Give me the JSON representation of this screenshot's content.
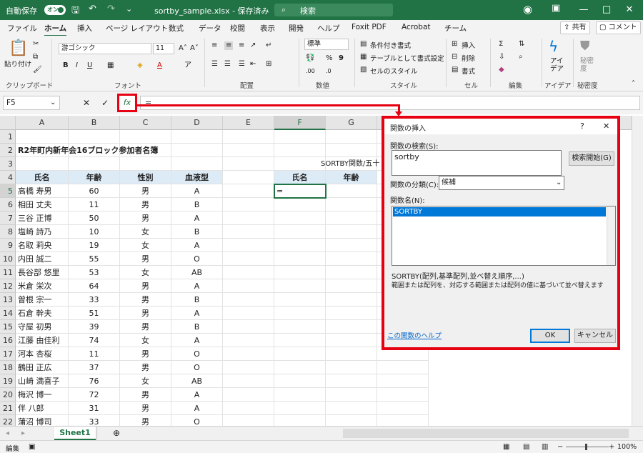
{
  "titlebar": {
    "autosave": "自動保存",
    "toggle": "オン",
    "filename": "sortby_sample.xlsx - 保存済み",
    "search": "検索",
    "minimize": "—",
    "maximize": "□",
    "close": "✕"
  },
  "tabs": [
    "ファイル",
    "ホーム",
    "挿入",
    "ページ レイアウト",
    "数式",
    "データ",
    "校閲",
    "表示",
    "開発",
    "ヘルプ",
    "Foxit PDF",
    "Acrobat",
    "チーム"
  ],
  "tab_buttons": {
    "share": "共有",
    "comment": "コメント"
  },
  "ribbon": {
    "clipboard": {
      "paste": "貼り付け",
      "label": "クリップボード"
    },
    "font": {
      "name": "游ゴシック",
      "size": "11",
      "label": "フォント"
    },
    "alignment": {
      "label": "配置"
    },
    "number": {
      "format": "標準",
      "label": "数値"
    },
    "style": {
      "cond": "条件付き書式",
      "table": "テーブルとして書式設定",
      "cell": "セルのスタイル",
      "label": "スタイル"
    },
    "cells": {
      "insert": "挿入",
      "delete": "削除",
      "format": "書式",
      "label": "セル"
    },
    "edit": {
      "label": "編集"
    },
    "idea": {
      "btn": "アイ デア",
      "label": "アイデア"
    },
    "sensitivity": {
      "btn": "秘密 度",
      "label": "秘密度"
    }
  },
  "formula_bar": {
    "namebox": "F5",
    "fx": "fx",
    "formula": "="
  },
  "columns": [
    "A",
    "B",
    "C",
    "D",
    "E",
    "F",
    "G"
  ],
  "rows": [
    "1",
    "2",
    "3",
    "4",
    "5",
    "6",
    "7",
    "8",
    "9",
    "10",
    "11",
    "12",
    "13",
    "14",
    "15",
    "16",
    "17",
    "18",
    "19",
    "20",
    "21",
    "22"
  ],
  "sheet": {
    "title": "R2年町内新年会16ブロック参加者名簿",
    "headers": [
      "氏名",
      "年齢",
      "性別",
      "血液型"
    ],
    "note": "SORTBY関数/五十",
    "out_headers": [
      "氏名",
      "年齢"
    ],
    "active_value": "=",
    "records": [
      [
        "高橋 寿男",
        "60",
        "男",
        "A"
      ],
      [
        "相田 丈夫",
        "11",
        "男",
        "B"
      ],
      [
        "三谷 正博",
        "50",
        "男",
        "A"
      ],
      [
        "塩崎 詩乃",
        "10",
        "女",
        "B"
      ],
      [
        "名取 莉央",
        "19",
        "女",
        "A"
      ],
      [
        "内田 誠二",
        "55",
        "男",
        "O"
      ],
      [
        "長谷部 悠里",
        "53",
        "女",
        "AB"
      ],
      [
        "米倉 栄次",
        "64",
        "男",
        "A"
      ],
      [
        "曽根 宗一",
        "33",
        "男",
        "B"
      ],
      [
        "石倉 幹夫",
        "51",
        "男",
        "A"
      ],
      [
        "守屋 初男",
        "39",
        "男",
        "B"
      ],
      [
        "江藤 由佳利",
        "74",
        "女",
        "A"
      ],
      [
        "河本 杏桜",
        "11",
        "男",
        "O"
      ],
      [
        "鶴田 正広",
        "37",
        "男",
        "O"
      ],
      [
        "山崎 満喜子",
        "76",
        "女",
        "AB"
      ],
      [
        "梅沢 博一",
        "72",
        "男",
        "A"
      ],
      [
        "伴 八郎",
        "31",
        "男",
        "A"
      ],
      [
        "蒲沼 博司",
        "33",
        "男",
        "O"
      ]
    ]
  },
  "sheet_tab": "Sheet1",
  "status": {
    "mode": "編集",
    "zoom": "100%"
  },
  "dialog": {
    "title": "関数の挿入",
    "help_q": "?",
    "close": "✕",
    "search_label": "関数の検索(S):",
    "search_value": "sortby",
    "search_btn": "検索開始(G)",
    "category_label": "関数の分類(C):",
    "category_value": "候補",
    "name_label": "関数名(N):",
    "selected_fn": "SORTBY",
    "syntax": "SORTBY(配列,基準配列,並べ替え順序,...)",
    "description": "範囲または配列を、対応する範囲または配列の値に基づいて並べ替えます",
    "help_link": "この関数のヘルプ",
    "ok": "OK",
    "cancel": "キャンセル"
  }
}
